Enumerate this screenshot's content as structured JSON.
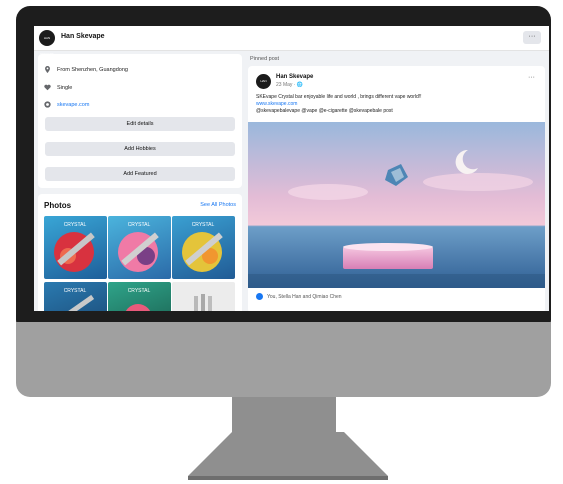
{
  "header": {
    "logo_text": "HAN SKEVAPE",
    "page_name": "Han Skevape",
    "more_label": "···"
  },
  "about": {
    "from": "From Shenzhen, Guangdong",
    "relationship": "Single",
    "website": "skevape.com",
    "buttons": [
      "Edit details",
      "Add Hobbies",
      "Add Featured"
    ]
  },
  "photos": {
    "title": "Photos",
    "see_all": "See All Photos",
    "tile_label": "CRYSTAL"
  },
  "post": {
    "pinned_label": "Pinned post",
    "author": "Han Skevape",
    "date": "23 May · 🌐",
    "more": "···",
    "line1": "SKEvape Crystal bar enjoyable life and world , brings different vape world!!",
    "line2": "www.skevape.com",
    "line3": "@skevapebalevape @vape @e-cigarette @skevapebale post",
    "reactions": "You, Stella Han and Qimiao Chen"
  },
  "colors": {
    "accent": "#1877f2",
    "bezel": "#1d1d1d",
    "chin": "#a0a0a0"
  }
}
